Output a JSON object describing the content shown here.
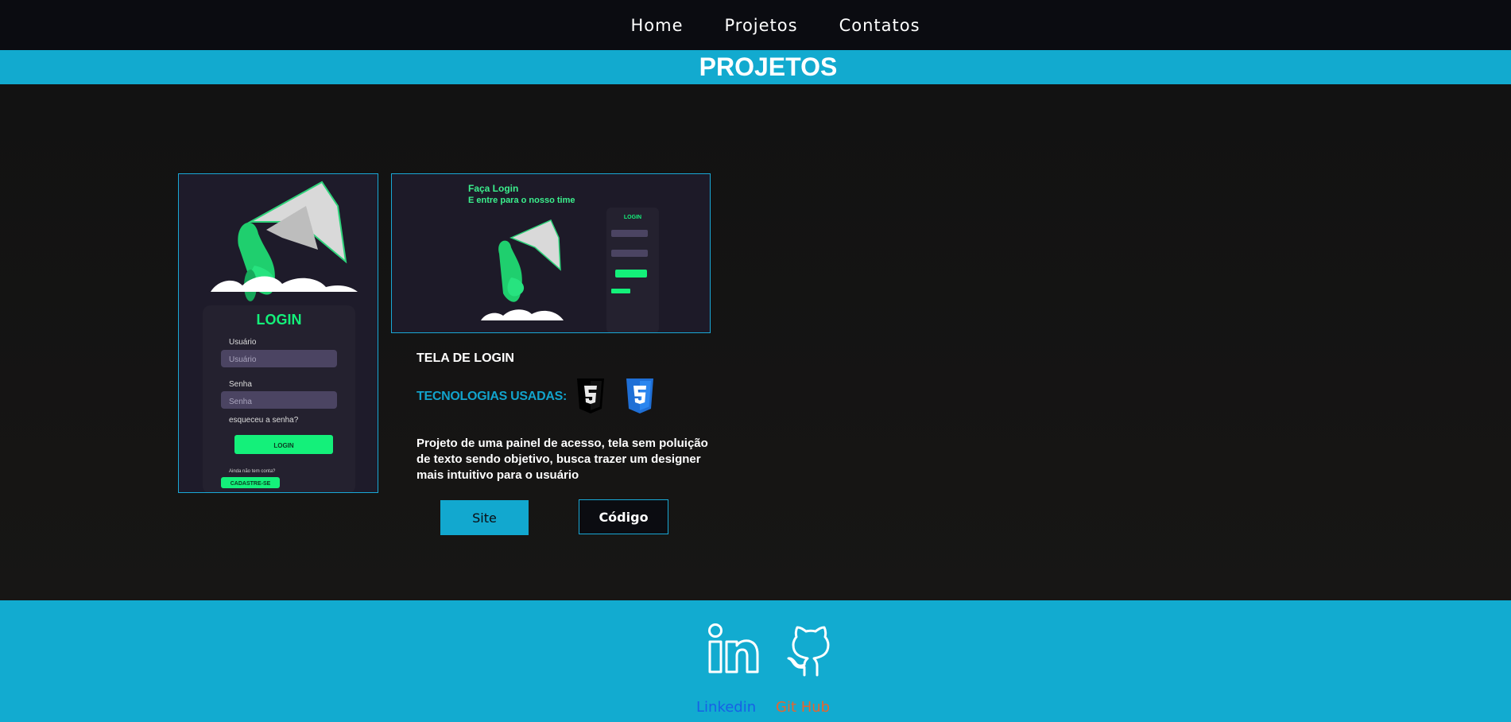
{
  "nav": {
    "items": [
      {
        "label": "Home"
      },
      {
        "label": "Projetos"
      },
      {
        "label": "Contatos"
      }
    ]
  },
  "banner": {
    "title": "PROJETOS"
  },
  "project": {
    "title": "TELA DE LOGIN",
    "tech_label": "TECNOLOGIAS USADAS:",
    "technologies": [
      "html5-icon",
      "css3-icon"
    ],
    "description": "Projeto de uma painel de acesso, tela sem poluição de texto sendo objetivo, busca trazer um designer mais intuitivo para o usuário",
    "site_button": "Site",
    "code_button": "Código",
    "preview_tall": {
      "login_title": "LOGIN",
      "user_label": "Usuário",
      "user_placeholder": "Usuário",
      "pass_label": "Senha",
      "pass_placeholder": "Senha",
      "forgot": "esqueceu a senha?",
      "login_button": "LOGIN",
      "no_account": "Ainda não tem conta?",
      "signup_button": "CADASTRE-SE"
    },
    "preview_wide": {
      "headline_1": "Faça Login",
      "headline_2": "E entre para o nosso time",
      "login_title": "LOGIN"
    }
  },
  "footer": {
    "linkedin_label": "Linkedin",
    "github_label": "Git Hub"
  },
  "colors": {
    "accent": "#12abd0",
    "dark": "#0b0c11",
    "green": "#14f07a"
  }
}
